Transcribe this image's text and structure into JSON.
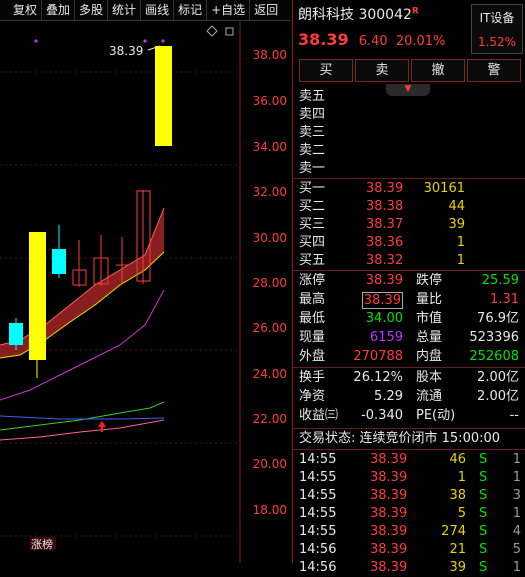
{
  "toolbar": {
    "items": [
      "复权",
      "叠加",
      "多股",
      "统计",
      "画线",
      "标记",
      "+自选",
      "返回"
    ]
  },
  "chart": {
    "y_ticks": [
      "38.00",
      "36.00",
      "34.00",
      "32.00",
      "30.00",
      "28.00",
      "26.00",
      "24.00",
      "22.00",
      "20.00",
      "18.00"
    ],
    "peak_label": "38.39",
    "tag": "涨榜",
    "colors": {
      "limit_up_bar": "#ffff00",
      "up_candle": "#ff3b3b",
      "down_candle": "#00ffff",
      "grid": "#6a1a1a"
    }
  },
  "header": {
    "name": "朗科科技",
    "code": "300042",
    "flag": "R",
    "price": "38.39",
    "change": "6.40",
    "change_pct": "20.01%",
    "sector": "IT设备",
    "sector_pct": "1.52%"
  },
  "trade_buttons": [
    "买",
    "卖",
    "撤",
    "警"
  ],
  "sell_levels": [
    "卖五",
    "卖四",
    "卖三",
    "卖二",
    "卖一"
  ],
  "buy_levels": [
    {
      "label": "买一",
      "price": "38.39",
      "vol": "30161"
    },
    {
      "label": "买二",
      "price": "38.38",
      "vol": "44"
    },
    {
      "label": "买三",
      "price": "38.37",
      "vol": "39"
    },
    {
      "label": "买四",
      "price": "38.36",
      "vol": "1"
    },
    {
      "label": "买五",
      "price": "38.32",
      "vol": "1"
    }
  ],
  "stats1": [
    {
      "l1": "涨停",
      "v1": "38.39",
      "l2": "跌停",
      "v2": "25.59"
    },
    {
      "l1": "最高",
      "v1": "38.39",
      "l2": "量比",
      "v2": "1.31"
    },
    {
      "l1": "最低",
      "v1": "34.00",
      "l2": "市值",
      "v2": "76.9亿"
    },
    {
      "l1": "现量",
      "v1": "6159",
      "l2": "总量",
      "v2": "523396"
    },
    {
      "l1": "外盘",
      "v1": "270788",
      "l2": "内盘",
      "v2": "252608"
    }
  ],
  "stats2": [
    {
      "l1": "换手",
      "v1": "26.12%",
      "l2": "股本",
      "v2": "2.00亿"
    },
    {
      "l1": "净资",
      "v1": "5.29",
      "l2": "流通",
      "v2": "2.00亿"
    },
    {
      "l1": "收益㈢",
      "v1": "-0.340",
      "l2": "PE(动)",
      "v2": "--"
    }
  ],
  "status": "交易状态: 连续竞价闭市 15:00:00",
  "ticks": [
    {
      "time": "14:55",
      "price": "38.39",
      "vol": "46",
      "side": "S",
      "n": "1"
    },
    {
      "time": "14:55",
      "price": "38.39",
      "vol": "1",
      "side": "S",
      "n": "1"
    },
    {
      "time": "14:55",
      "price": "38.39",
      "vol": "38",
      "side": "S",
      "n": "3"
    },
    {
      "time": "14:55",
      "price": "38.39",
      "vol": "5",
      "side": "S",
      "n": "1"
    },
    {
      "time": "14:55",
      "price": "38.39",
      "vol": "274",
      "side": "S",
      "n": "4"
    },
    {
      "time": "14:56",
      "price": "38.39",
      "vol": "21",
      "side": "S",
      "n": "5"
    },
    {
      "time": "14:56",
      "price": "38.39",
      "vol": "39",
      "side": "S",
      "n": "1"
    }
  ]
}
